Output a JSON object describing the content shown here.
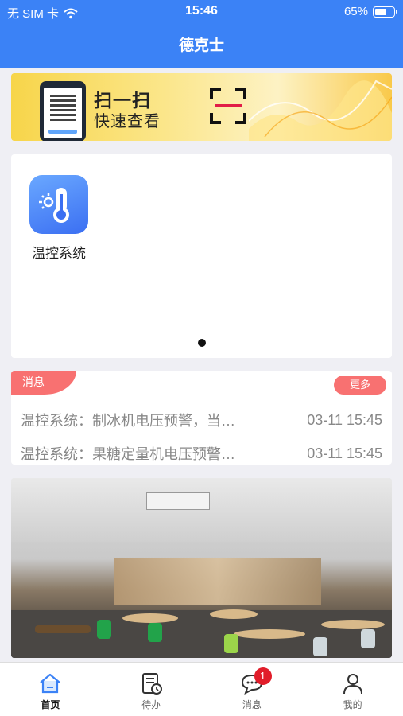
{
  "status_bar": {
    "carrier": "无 SIM 卡",
    "time": "15:46",
    "battery": "65%",
    "battery_level": 0.65
  },
  "nav": {
    "title": "德克士"
  },
  "banner": {
    "line1": "扫一扫",
    "line2": "快速查看"
  },
  "apps": [
    {
      "label": "温控系统",
      "icon": "thermometer-sun-icon"
    }
  ],
  "messages": {
    "tag": "消息",
    "more": "更多",
    "items": [
      {
        "text": "温控系统：制冰机电压预警，当…",
        "time": "03-11 15:45"
      },
      {
        "text": "温控系统：果糖定量机电压预警…",
        "time": "03-11 15:45"
      }
    ]
  },
  "tabs": [
    {
      "label": "首页",
      "icon": "home-icon",
      "active": true
    },
    {
      "label": "待办",
      "icon": "todo-icon"
    },
    {
      "label": "消息",
      "icon": "chat-icon",
      "badge": "1"
    },
    {
      "label": "我的",
      "icon": "user-icon"
    }
  ],
  "colors": {
    "primary": "#3b82f6",
    "accent_red": "#f87171",
    "badge_red": "#e11d2a"
  }
}
